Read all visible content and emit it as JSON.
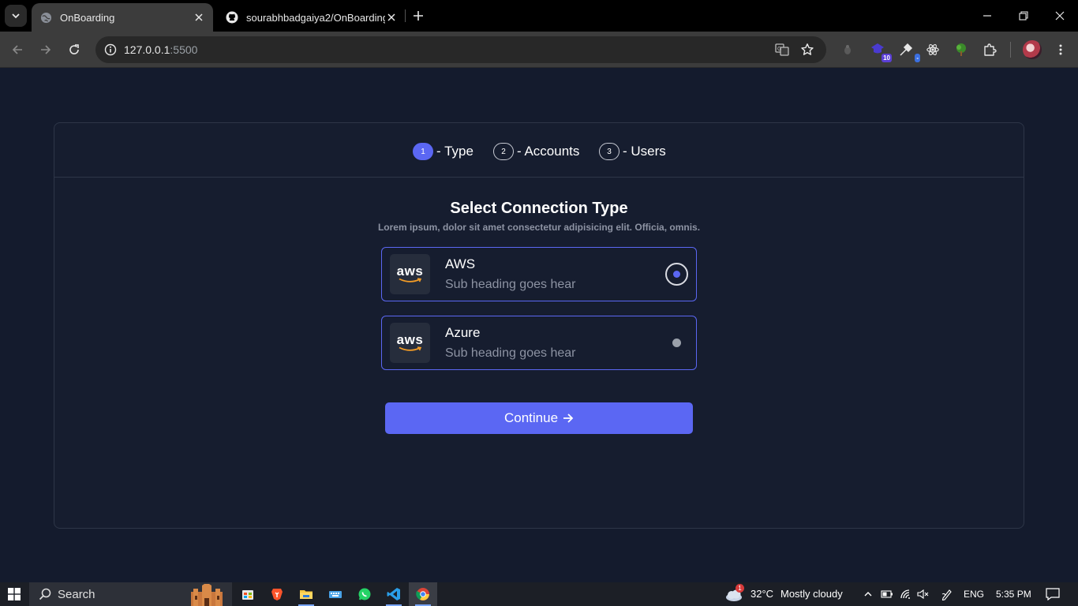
{
  "browser": {
    "tabs": [
      {
        "title": "OnBoarding",
        "active": true
      },
      {
        "title": "sourabhbadgaiya2/OnBoarding",
        "active": false
      }
    ],
    "url_host": "127.0.0.1",
    "url_port": ":5500",
    "extensions": [
      {
        "name": "extension-icon",
        "badge": ""
      },
      {
        "name": "extension-icon",
        "badge": "10",
        "badge_color": "#5b3fd6"
      },
      {
        "name": "extension-icon",
        "badge": "-",
        "badge_color": "#3b6fe0"
      },
      {
        "name": "react-devtools-icon",
        "badge": ""
      },
      {
        "name": "tree-extension-icon",
        "badge": ""
      },
      {
        "name": "puzzle-icon",
        "badge": ""
      }
    ]
  },
  "onboarding": {
    "steps": [
      {
        "number": "1",
        "label": "- Type",
        "active": true
      },
      {
        "number": "2",
        "label": "- Accounts",
        "active": false
      },
      {
        "number": "3",
        "label": "- Users",
        "active": false
      }
    ],
    "heading": "Select Connection Type",
    "subheading": "Lorem ipsum, dolor sit amet consectetur adipisicing elit. Officia, omnis.",
    "options": [
      {
        "logo_text": "aws",
        "title": "AWS",
        "subtitle": "Sub heading goes hear",
        "selected": true
      },
      {
        "logo_text": "aws",
        "title": "Azure",
        "subtitle": "Sub heading goes hear",
        "selected": false
      }
    ],
    "continue_label": "Continue"
  },
  "colors": {
    "accent": "#5b67f3",
    "background": "#141b2d",
    "card": "#161d2f",
    "muted_text": "#8d93a3"
  },
  "taskbar": {
    "search_label": "Search",
    "weather_temp": "32°C",
    "weather_text": "Mostly cloudy",
    "weather_badge": "1",
    "language": "ENG",
    "time": "5:35 PM"
  }
}
